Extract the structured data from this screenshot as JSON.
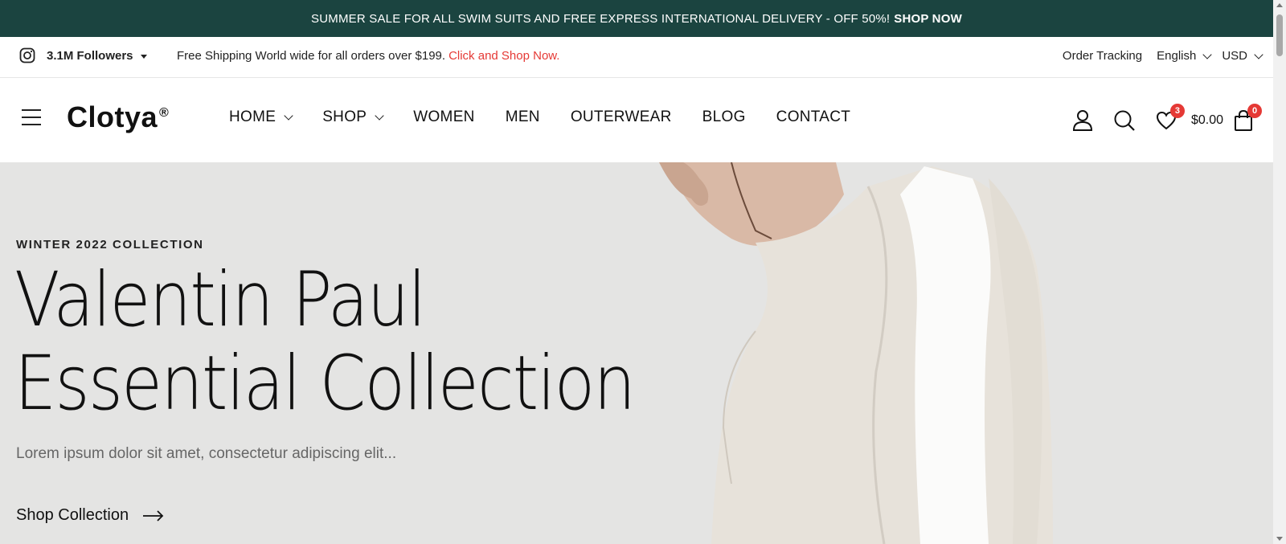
{
  "promo": {
    "text": "SUMMER SALE FOR ALL SWIM SUITS AND FREE EXPRESS INTERNATIONAL DELIVERY - OFF 50%!",
    "cta": "SHOP NOW"
  },
  "topbar": {
    "followers": "3.1M Followers",
    "shipping_text": "Free Shipping World wide for all orders over $199.",
    "shipping_link": "Click and Shop Now.",
    "order_tracking": "Order Tracking",
    "language": "English",
    "currency": "USD"
  },
  "header": {
    "logo": "Clotya",
    "logo_mark": "®",
    "nav": [
      {
        "label": "HOME"
      },
      {
        "label": "SHOP"
      },
      {
        "label": "WOMEN"
      },
      {
        "label": "MEN"
      },
      {
        "label": "OUTERWEAR"
      },
      {
        "label": "BLOG"
      },
      {
        "label": "CONTACT"
      }
    ],
    "wishlist_count": "3",
    "cart_total": "$0.00",
    "cart_count": "0"
  },
  "hero": {
    "eyebrow": "WINTER 2022 COLLECTION",
    "title_line1": "Valentin Paul",
    "title_line2": "Essential Collection",
    "subtitle": "Lorem ipsum dolor sit amet, consectetur adipiscing elit...",
    "cta": "Shop Collection"
  },
  "colors": {
    "promo_bg": "#1b4440",
    "accent": "#e53935",
    "hero_bg": "#e4e4e3"
  }
}
